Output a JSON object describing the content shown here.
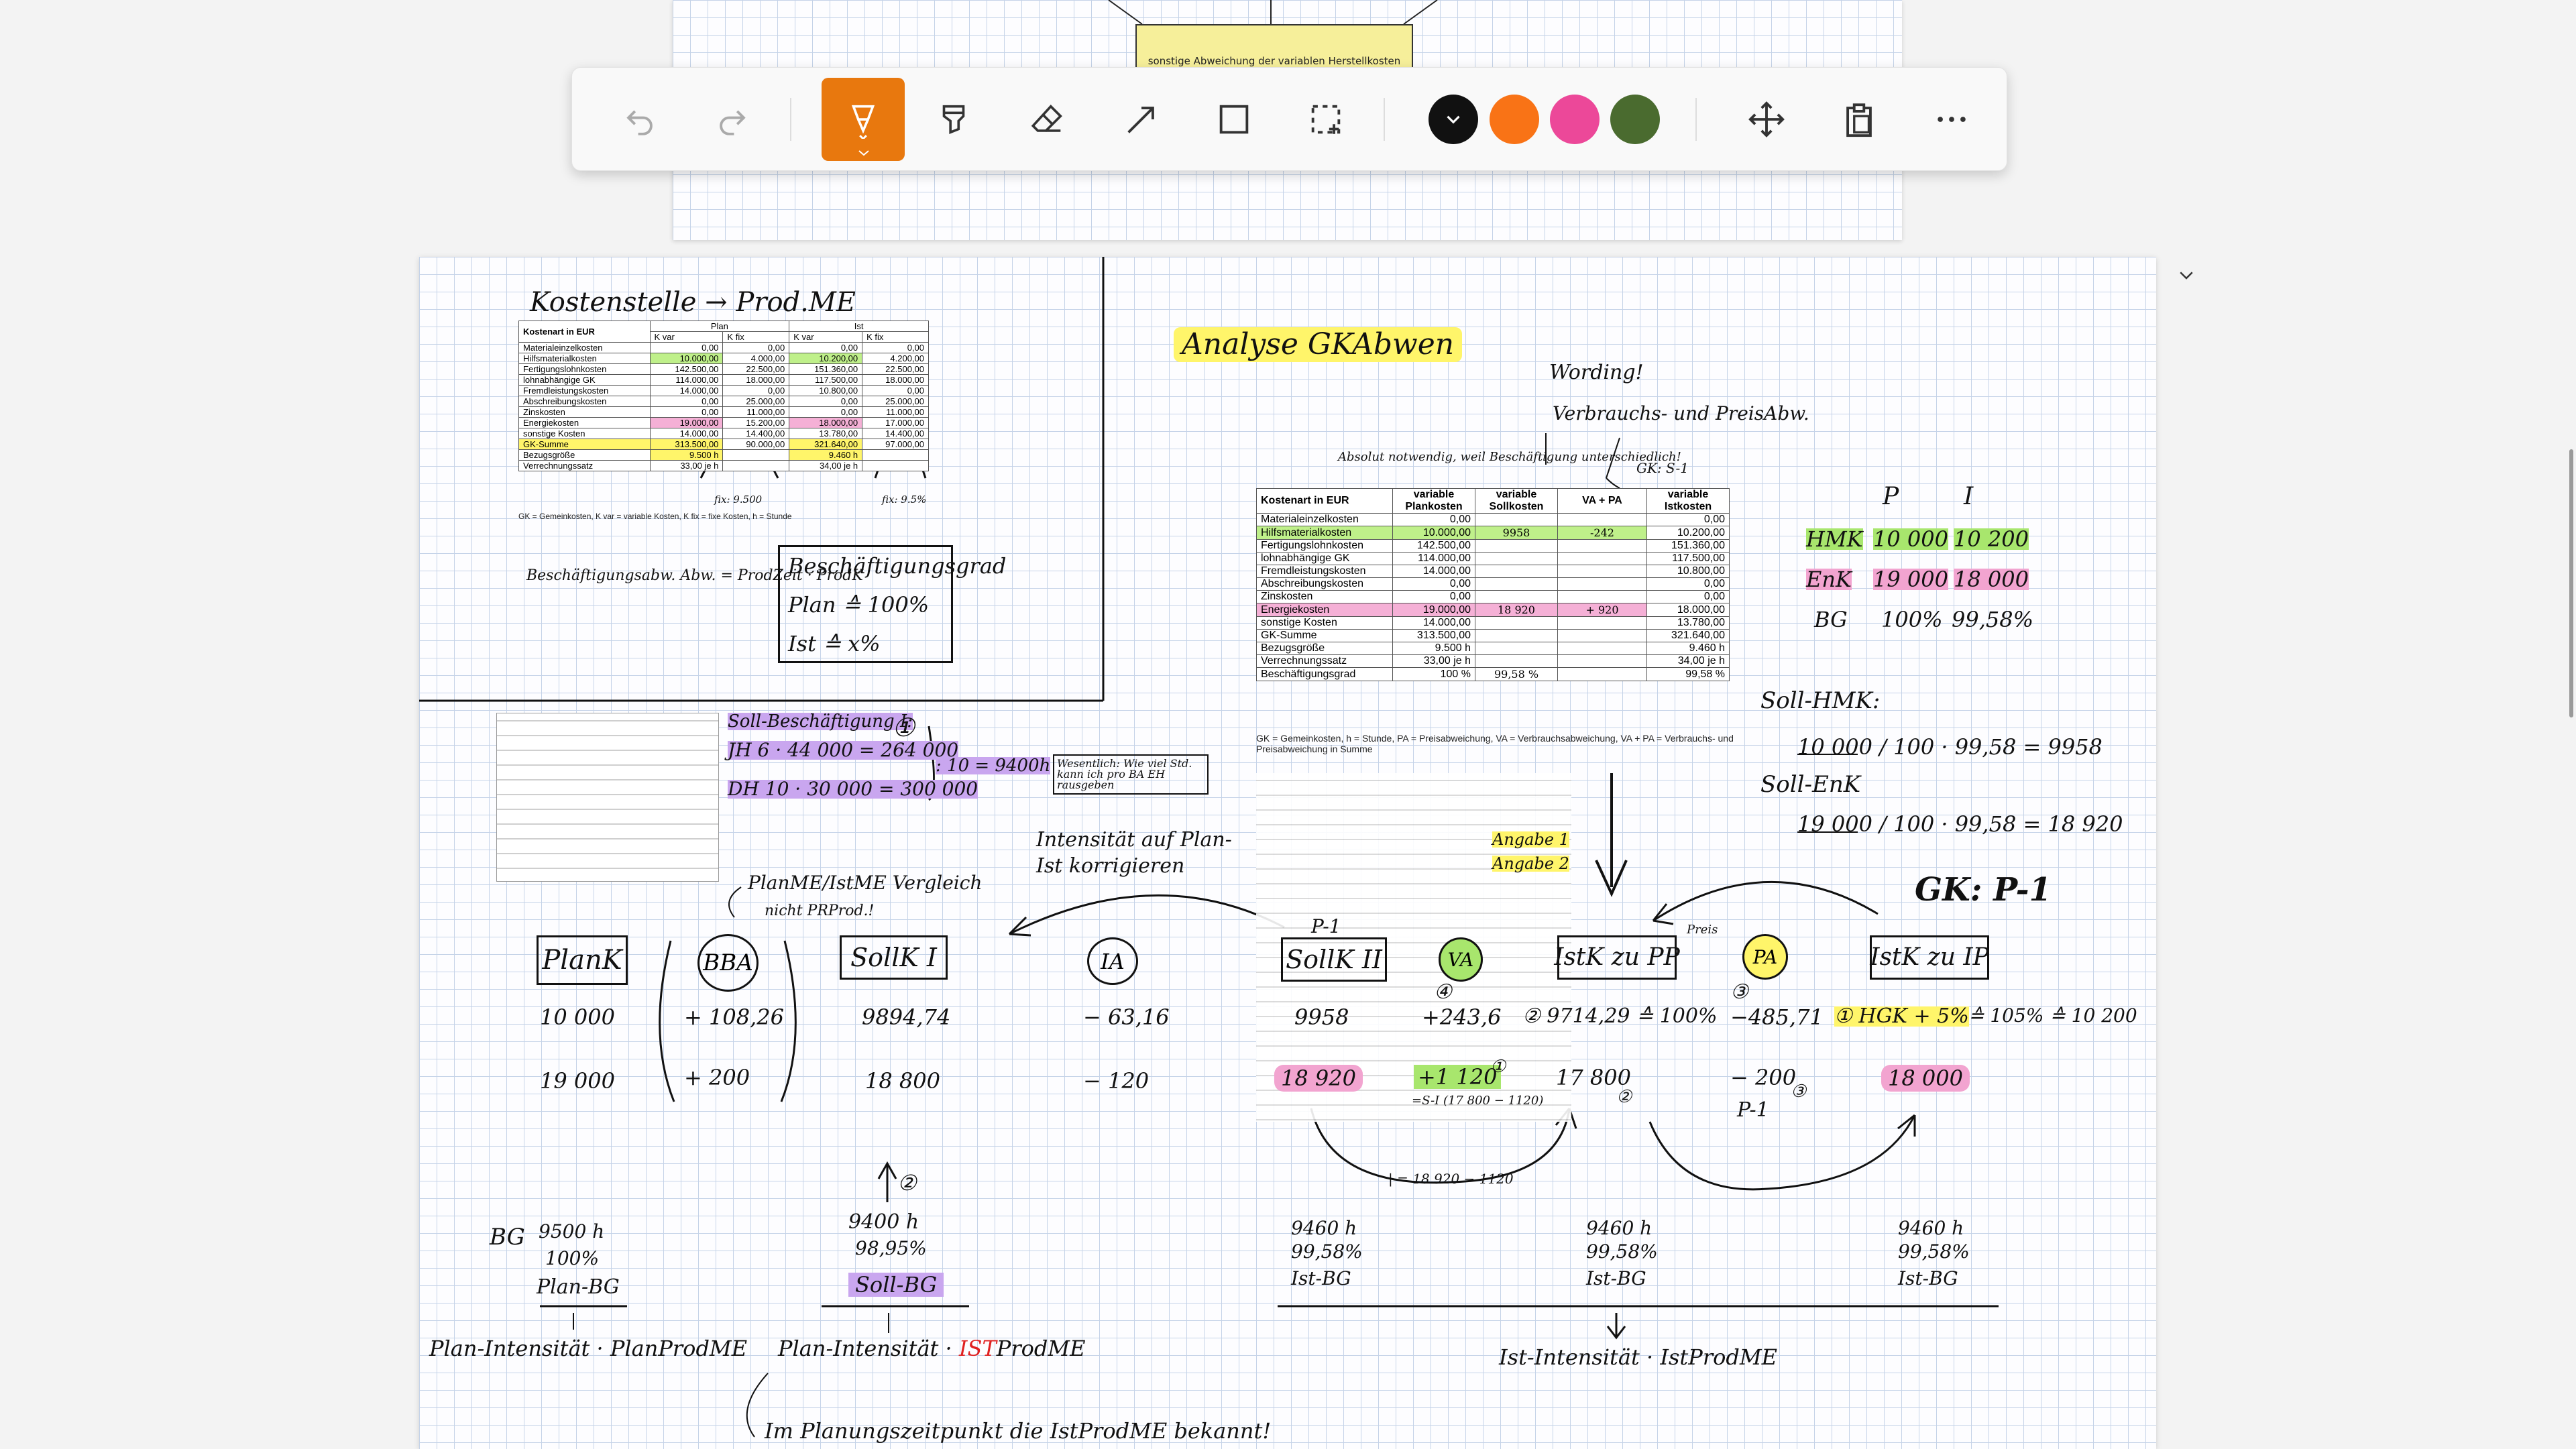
{
  "toolbar": {
    "tools": [
      {
        "name": "undo",
        "label": "Undo"
      },
      {
        "name": "redo",
        "label": "Redo"
      },
      {
        "name": "pen",
        "label": "Pen"
      },
      {
        "name": "highlighter",
        "label": "Highlighter"
      },
      {
        "name": "eraser",
        "label": "Eraser"
      },
      {
        "name": "line",
        "label": "Line"
      },
      {
        "name": "rectangle",
        "label": "Rectangle"
      },
      {
        "name": "lasso",
        "label": "Lasso select"
      },
      {
        "name": "pan",
        "label": "Pan"
      },
      {
        "name": "paste",
        "label": "Paste"
      },
      {
        "name": "more",
        "label": "More"
      }
    ],
    "colors": [
      "#111111",
      "#f97316",
      "#ec4899",
      "#4a6b2f"
    ],
    "active_tool_color": "#e8780e"
  },
  "top_page": {
    "box_label": "sonstige Abweichung der variablen Herstellkosten"
  },
  "notes": {
    "kostenstelle": "Kostenstelle → Prod.ME",
    "besch_note": "Beschäftigungsabw. Abw. = ProdZeit · ProdK",
    "besch_box": [
      "Beschäftigungsgrad",
      "Plan ≙ 100%",
      "Ist ≙ x%"
    ],
    "analyse_title": "Analyse GKAbwen",
    "wording": "Wording!",
    "verbrauch": "Verbrauchs- und PreisAbw.",
    "gk_s1": "GK: S-1",
    "absolut": "Absolut notwendig, weil Beschäftigung unterschiedlich!",
    "soll_besch": [
      "Soll-Beschäftigung I:",
      "JH 6 · 44 000 = 264 000",
      "DH 10 · 30 000 = 300 000",
      ": 10 = 9400h"
    ],
    "wenig": "Wesentlich: Wie viel Std. kann ich pro BA EH rausgeben",
    "intensitaet": "Intensität auf Plan-Ist korrigieren",
    "angabe1": "Angabe 1",
    "angabe2": "Angabe 2",
    "planme": "PlanME/IstME Vergleich",
    "nicht": "nicht PRProd.!",
    "gk_p1": "GK: P-1",
    "p_label": "P",
    "i_label": "I",
    "hmk_row": [
      "HMK",
      "10 000",
      "10 200"
    ],
    "enk_row": [
      "EnK",
      "19 000",
      "18 000"
    ],
    "bg_row": [
      "BG",
      "100%",
      "99,58%"
    ],
    "soll_hmk": "Soll-HMK:",
    "soll_hmk_calc": "10 000 / 100 · 99,58 = 9958",
    "soll_enk": "Soll-EnK",
    "soll_enk_calc": "19 000 / 100 · 99,58 = 18 920",
    "preis": "Preis"
  },
  "flow": {
    "plank": "PlanK",
    "bba": "BBA",
    "sollk1": "SollK I",
    "ia": "IA",
    "sollk2": "SollK II",
    "va": "VA",
    "istk_pp": "IstK zu PP",
    "pa": "PA",
    "istk_ip": "IstK zu IP",
    "p1_label": "P-1",
    "row1": [
      "10 000",
      "+ 108,26",
      "9894,74",
      "− 63,16",
      "9958",
      "+243,6",
      "② 9714,29 ≙ 100%",
      "−485,71",
      "① HGK + 5%",
      "≙ 105% ≙ 10 200"
    ],
    "row2": [
      "19 000",
      "+ 200",
      "18 800",
      "− 120",
      "18 920",
      "+1 120",
      "17 800",
      "− 200",
      "18 000"
    ],
    "va_sub": "=S-I (17 800 − 1120)",
    "pa_sub": "P-1",
    "arrow_note": "| = 18 920 − 1120",
    "circled": [
      "①",
      "②",
      "③",
      "④"
    ]
  },
  "bottom": {
    "bg_label": "BG",
    "plan_bg": [
      "9500 h",
      "100%",
      "Plan-BG"
    ],
    "plan_formula": "Plan-Intensität · PlanProdME",
    "soll_bg": [
      "9400 h",
      "98,95%",
      "Soll-BG"
    ],
    "soll_formula_a": "Plan-Intensität · ",
    "soll_formula_b": "IST",
    "soll_formula_c": "ProdME",
    "ist_bg1": [
      "9460 h",
      "99,58%",
      "Ist-BG"
    ],
    "ist_bg2": [
      "9460 h",
      "99,58%",
      "Ist-BG"
    ],
    "ist_bg3": [
      "9460 h",
      "99,58%",
      "Ist-BG"
    ],
    "ist_formula": "Ist-Intensität · IstProdME",
    "note": "Im Planungszeitpunkt die IstProdME bekannt!"
  },
  "table_small": {
    "headers": [
      "Kostenart in EUR",
      "K var",
      "K fix",
      "K var",
      "K fix"
    ],
    "group_headers": [
      "Plan",
      "Ist"
    ],
    "rows": [
      [
        "Materialeinzelkosten",
        "0,00",
        "0,00",
        "0,00",
        "0,00"
      ],
      [
        "Hilfsmaterialkosten",
        "10.000,00",
        "4.000,00",
        "10.200,00",
        "4.200,00"
      ],
      [
        "Fertigungslohnkosten",
        "142.500,00",
        "22.500,00",
        "151.360,00",
        "22.500,00"
      ],
      [
        "lohnabhängige GK",
        "114.000,00",
        "18.000,00",
        "117.500,00",
        "18.000,00"
      ],
      [
        "Fremdleistungskosten",
        "14.000,00",
        "0,00",
        "10.800,00",
        "0,00"
      ],
      [
        "Abschreibungskosten",
        "0,00",
        "25.000,00",
        "0,00",
        "25.000,00"
      ],
      [
        "Zinskosten",
        "0,00",
        "11.000,00",
        "0,00",
        "11.000,00"
      ],
      [
        "Energiekosten",
        "19.000,00",
        "15.200,00",
        "18.000,00",
        "17.000,00"
      ],
      [
        "sonstige Kosten",
        "14.000,00",
        "14.400,00",
        "13.780,00",
        "14.400,00"
      ],
      [
        "GK-Summe",
        "313.500,00",
        "90.000,00",
        "321.640,00",
        "97.000,00"
      ],
      [
        "Bezugsgröße",
        "9.500 h",
        "",
        "9.460 h",
        ""
      ],
      [
        "Verrechnungssatz",
        "33,00 je h",
        "",
        "34,00 je h",
        ""
      ]
    ],
    "footnote": "GK = Gemeinkosten, K var = variable Kosten, K fix = fixe Kosten, h = Stunde",
    "side_notes": [
      "fix: 9.500",
      "fix: 9.5%"
    ]
  },
  "table_mid": {
    "headers": [
      "Kostenart in EUR",
      "variable Plankosten",
      "variable Sollkosten",
      "VA + PA",
      "variable Istkosten"
    ],
    "rows": [
      [
        "Materialeinzelkosten",
        "0,00",
        "",
        "",
        "0,00"
      ],
      [
        "Hilfsmaterialkosten",
        "10.000,00",
        "9958",
        "-242",
        "10.200,00"
      ],
      [
        "Fertigungslohnkosten",
        "142.500,00",
        "",
        "",
        "151.360,00"
      ],
      [
        "lohnabhängige GK",
        "114.000,00",
        "",
        "",
        "117.500,00"
      ],
      [
        "Fremdleistungskosten",
        "14.000,00",
        "",
        "",
        "10.800,00"
      ],
      [
        "Abschreibungskosten",
        "0,00",
        "",
        "",
        "0,00"
      ],
      [
        "Zinskosten",
        "0,00",
        "",
        "",
        "0,00"
      ],
      [
        "Energiekosten",
        "19.000,00",
        "18 920",
        "+ 920",
        "18.000,00"
      ],
      [
        "sonstige Kosten",
        "14.000,00",
        "",
        "",
        "13.780,00"
      ],
      [
        "GK-Summe",
        "313.500,00",
        "",
        "",
        "321.640,00"
      ],
      [
        "Bezugsgröße",
        "9.500 h",
        "",
        "",
        "9.460 h"
      ],
      [
        "Verrechnungssatz",
        "33,00 je h",
        "",
        "",
        "34,00 je h"
      ],
      [
        "Beschäftigungsgrad",
        "100 %",
        "99,58 %",
        "",
        "99,58 %"
      ]
    ],
    "footnote": "GK = Gemeinkosten, h = Stunde, PA = Preisabweichung, VA = Verbrauchsabweichung, VA + PA = Verbrauchs- und Preisabweichung in Summe"
  }
}
